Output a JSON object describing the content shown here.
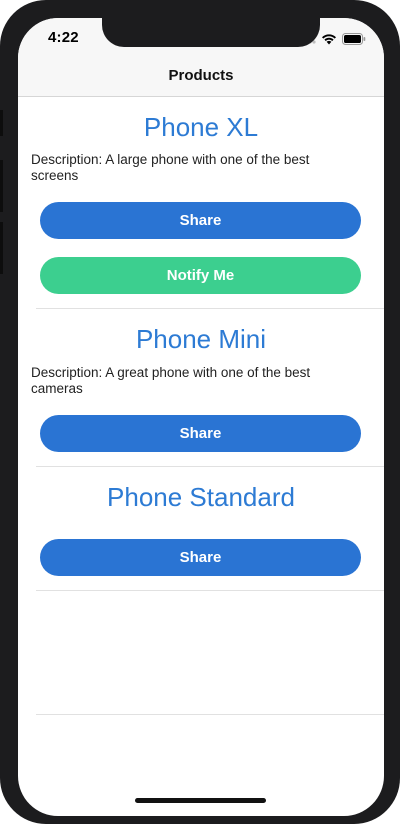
{
  "status_bar": {
    "time": "4:22",
    "icons": [
      "cellular-dots-icon",
      "wifi-icon",
      "battery-icon"
    ]
  },
  "nav": {
    "title": "Products"
  },
  "products": [
    {
      "name": "Phone XL",
      "description": "Description: A large phone with one of the best screens",
      "share_label": "Share",
      "notify_label": "Notify Me"
    },
    {
      "name": "Phone Mini",
      "description": "Description: A great phone with one of the best cameras",
      "share_label": "Share"
    },
    {
      "name": "Phone Standard",
      "share_label": "Share"
    }
  ],
  "colors": {
    "accent_blue": "#2a74d3",
    "title_blue": "#2d7bd4",
    "notify_green": "#3ccf8f"
  }
}
